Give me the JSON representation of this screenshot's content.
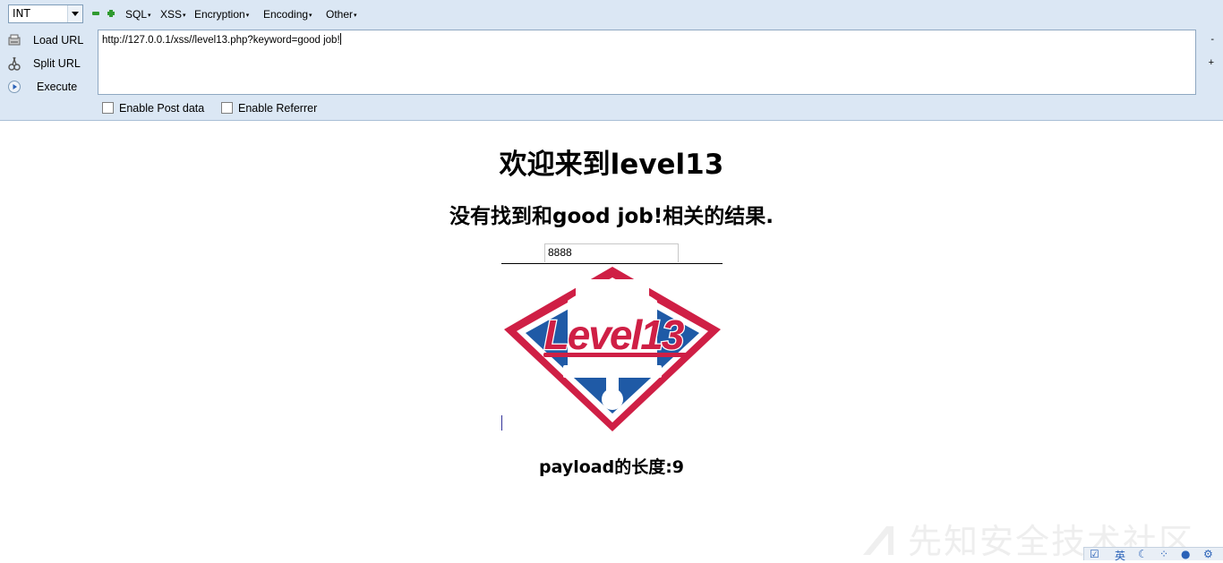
{
  "hackbar": {
    "type_select": "INT",
    "menus": [
      "SQL",
      "XSS",
      "Encryption",
      "Encoding",
      "Other"
    ],
    "actions": {
      "load": "Load URL",
      "split": "Split URL",
      "execute": "Execute"
    },
    "url": "http://127.0.0.1/xss//level13.php?keyword=good job!",
    "side_minus": "-",
    "side_plus": "+",
    "enable_post": "Enable Post data",
    "enable_referrer": "Enable Referrer"
  },
  "page": {
    "title": "欢迎来到level13",
    "result": "没有找到和good job!相关的结果.",
    "input_value": "8888",
    "payload_length": "payload的长度:9"
  },
  "logo": {
    "text": "Level13",
    "colors": {
      "red": "#cf1f45",
      "blue": "#1f5aa6",
      "white": "#ffffff"
    }
  },
  "watermark": "先知安全技术社区",
  "tray": {
    "ime": "英"
  }
}
